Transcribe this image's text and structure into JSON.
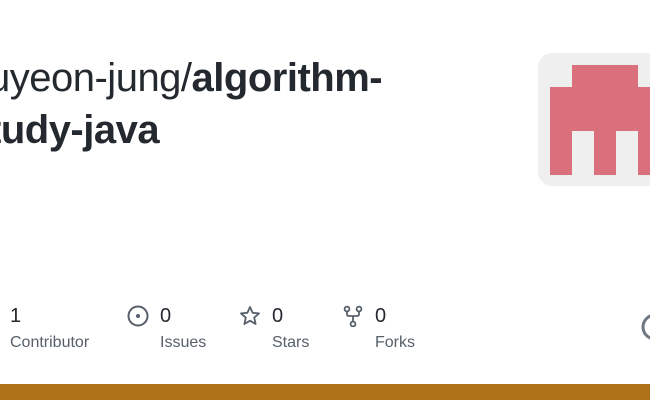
{
  "repo": {
    "owner_prefix": "uyeon-jung/",
    "name_line1": "algorithm-",
    "name_line2": "tudy-java"
  },
  "avatar": {
    "color": "#d9707c",
    "background": "#efefef"
  },
  "stats": [
    {
      "count": "1",
      "label": "Contributor",
      "icon": "contributor-icon"
    },
    {
      "count": "0",
      "label": "Issues",
      "icon": "issue-icon"
    },
    {
      "count": "0",
      "label": "Stars",
      "icon": "star-icon"
    },
    {
      "count": "0",
      "label": "Forks",
      "icon": "fork-icon"
    }
  ],
  "colors": {
    "text": "#24292f",
    "muted": "#57606a",
    "icon": "#57606a",
    "language_bar": "#b07219"
  }
}
